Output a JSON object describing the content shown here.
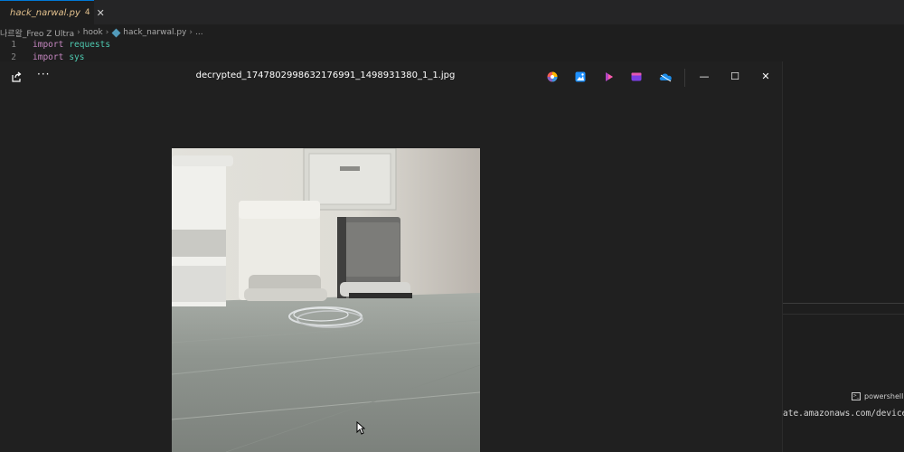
{
  "editor": {
    "tab": {
      "filename": "hack_narwal.py",
      "problems": "4",
      "close": "✕"
    },
    "breadcrumb": {
      "folder": "나르왈_Freo Z Ultra",
      "subfolder": "hook",
      "file": "hack_narwal.py",
      "more": "..."
    },
    "code": [
      {
        "line": "1",
        "keyword": "import",
        "module": "requests"
      },
      {
        "line": "2",
        "keyword": "import",
        "module": "sys"
      }
    ],
    "terminal": {
      "tab_label": "powershell",
      "visible_text": "ate.amazonaws.com/device/vi"
    }
  },
  "viewer": {
    "title": "decrypted_1747802998632176991_1498931380_1_1.jpg",
    "more_label": "···",
    "app_icons": [
      "copilot-icon",
      "photos-editor-icon",
      "clipchamp-icon",
      "designer-icon",
      "onedrive-icon"
    ],
    "window_controls": {
      "minimize": "—",
      "maximize": "☐",
      "close": "✕"
    }
  },
  "colors": {
    "accent": "#0078d4",
    "modified_tab_text": "#e2c08d",
    "keyword": "#c586c0",
    "module": "#4ec9b0"
  }
}
